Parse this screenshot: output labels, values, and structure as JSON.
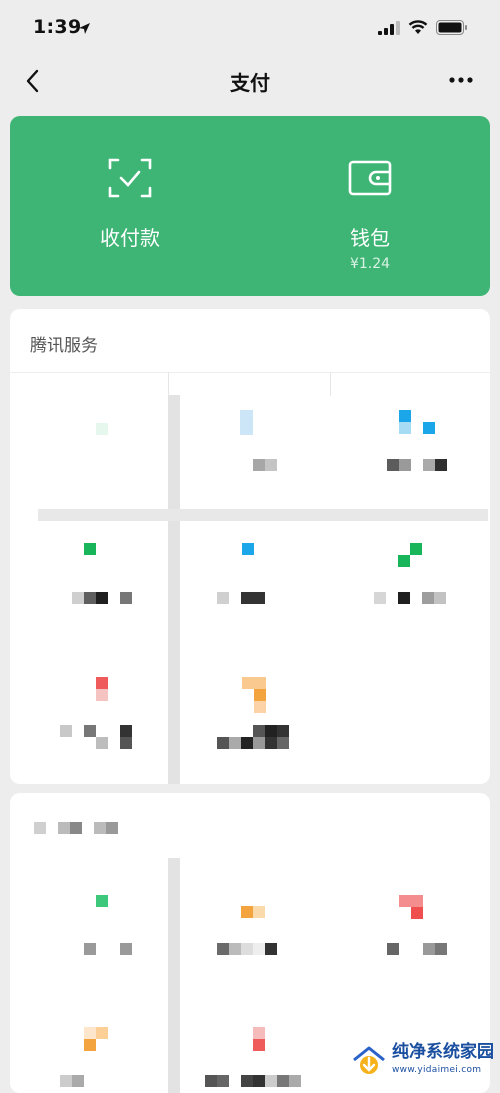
{
  "status_bar": {
    "time": "1:39",
    "icons": [
      "location-arrow-icon",
      "signal-icon",
      "wifi-icon",
      "battery-icon"
    ]
  },
  "nav": {
    "title": "支付",
    "back_icon": "chevron-left-icon",
    "more_icon": "more-dots-icon"
  },
  "pay_card": {
    "color": "#3eb575",
    "items": [
      {
        "label": "收付款",
        "icon": "scan-frame-icon"
      },
      {
        "label": "钱包",
        "sub": "¥1.24",
        "icon": "wallet-icon"
      }
    ]
  },
  "services": {
    "title": "腾讯服务"
  },
  "watermark": {
    "name": "纯净系统家园",
    "url": "www.yidaimei.com"
  }
}
